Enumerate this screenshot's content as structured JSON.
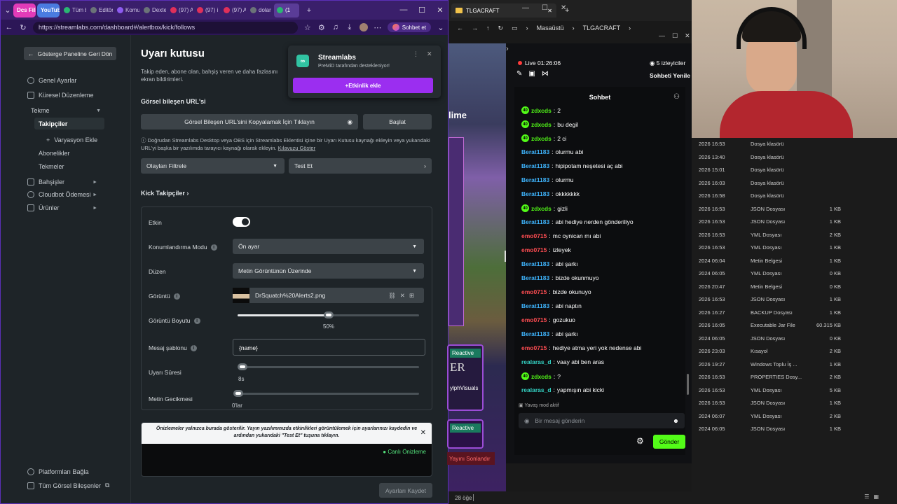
{
  "browser": {
    "tabs": [
      {
        "label": "Dcs Fili",
        "color": "#e23bb8",
        "group": true
      },
      {
        "label": "YouTub",
        "color": "#4a7be0",
        "group": true
      },
      {
        "label": "Tüm b",
        "color": "#2bb673"
      },
      {
        "label": "Editör",
        "color": "#6b7378"
      },
      {
        "label": "Komut",
        "color": "#8d5bf0"
      },
      {
        "label": "Dexte",
        "color": "#6b7378"
      },
      {
        "label": "(97) A",
        "color": "#e0305a"
      },
      {
        "label": "(97) i",
        "color": "#e0305a"
      },
      {
        "label": "(97) A",
        "color": "#e0305a"
      },
      {
        "label": "dolar",
        "color": "#6b7378"
      },
      {
        "label": "(1",
        "color": "#2bb673",
        "active": true
      }
    ],
    "url": "https://streamlabs.com/dashboard#/alertbox/kick/follows",
    "profile_label": "Sohbet et"
  },
  "sidebar": {
    "back_label": "Gösterge Paneline Geri Dön",
    "items": [
      {
        "label": "Genel Ayarlar"
      },
      {
        "label": "Küresel Düzenleme"
      },
      {
        "label": "Tekme"
      },
      {
        "label": "Takipçiler"
      },
      {
        "label": "Varyasyon Ekle"
      },
      {
        "label": "Abonelikler"
      },
      {
        "label": "Tekmeler"
      },
      {
        "label": "Bahşişler"
      },
      {
        "label": "Cloudbot Ödemesi"
      },
      {
        "label": "Ürünler"
      }
    ],
    "bottom": [
      {
        "label": "Platformları Bağla"
      },
      {
        "label": "Tüm Görsel Bileşenler"
      }
    ]
  },
  "main": {
    "title": "Uyarı kutusu",
    "description": "Takip eden, abone olan, bahşiş veren ve daha fazlasını",
    "description2": "ekran bildirimleri.",
    "url_section_label": "Görsel bileşen URL'si",
    "url_field_label": "Görsel Bileşen URL'sini Kopyalamak İçin Tıklayın",
    "start_button": "Başlat",
    "note": "Doğrudan Streamlabs Desktop veya OBS için Streamlabs Eklentisi içine bir Uyarı Kutusu kaynağı ekleyin veya yukarıdaki",
    "note2": "URL'yi başka bir yazılımda tarayıcı kaynağı olarak ekleyin.",
    "note_link": "Kılavuzu Göster",
    "filter_label": "Olayları Filtrele",
    "test_label": "Test Et",
    "section_title": "Kick Takipçiler",
    "rows": {
      "enabled": "Etkin",
      "position_mode": "Konumlandırma Modu",
      "position_value": "Ön ayar",
      "layout": "Düzen",
      "layout_value": "Metin Görüntünün Üzerinde",
      "image": "Görüntü",
      "image_file": "DrSquatch%20Alerts2.png",
      "image_size": "Görüntü Boyutu",
      "image_size_value": "50%",
      "message_template": "Mesaj şablonu",
      "message_value": "{name}",
      "alert_duration": "Uyarı Süresi",
      "alert_duration_value": "8s",
      "text_delay": "Metin Gecikmesi",
      "text_delay_value": "0'lar"
    },
    "image_size_fraction": 0.5,
    "preview_note": "Önizlemeler yalnızca burada gösterilir. Yayın yazılımınızda etkinlikleri görüntülemek için ayarlarınızı kaydedin ve",
    "preview_note2": "ardından yukarıdaki \"Test Et\" tuşuna tıklayın.",
    "live_preview": "Canlı Önizleme",
    "save_button": "Ayarları Kaydet"
  },
  "popup": {
    "title": "Streamlabs",
    "subtitle": "PreMiD tarafından destekleniyor!",
    "button": "Etkinlik ekle"
  },
  "explorer": {
    "title": "TLGACRAFT",
    "breadcrumb": [
      "Masaüstü",
      "TLGACRAFT"
    ],
    "status": "28 öğe"
  },
  "stream": {
    "live": "Live 01:26:06",
    "viewers": "5 izleyiciler",
    "refresh": "Sohbeti Yenile",
    "chat_title": "Sohbet",
    "messages": [
      {
        "user": "zdxcds",
        "text": "2",
        "color": "g",
        "badge": true
      },
      {
        "user": "zdxcds",
        "text": "bu degil",
        "color": "g",
        "badge": true
      },
      {
        "user": "zdxcds",
        "text": "2 ci",
        "color": "g",
        "badge": true
      },
      {
        "user": "Berat1183",
        "text": "olurmu abi",
        "color": "b"
      },
      {
        "user": "Berat1183",
        "text": "hipipotam neşetesi aç abi",
        "color": "b"
      },
      {
        "user": "Berat1183",
        "text": "olurmu",
        "color": "b"
      },
      {
        "user": "Berat1183",
        "text": "okkkkkkk",
        "color": "b"
      },
      {
        "user": "zdxcds",
        "text": "gizli",
        "color": "g",
        "badge": true
      },
      {
        "user": "Berat1183",
        "text": "abi hediye nerden gönderiliyo",
        "color": "b"
      },
      {
        "user": "emo0715",
        "text": "mc oynican mı abi",
        "color": "r"
      },
      {
        "user": "emo0715",
        "text": "izleyek",
        "color": "r"
      },
      {
        "user": "Berat1183",
        "text": "abi şarkı",
        "color": "b"
      },
      {
        "user": "Berat1183",
        "text": "bizde okunmuyo",
        "color": "b"
      },
      {
        "user": "emo0715",
        "text": "bizde okunuyo",
        "color": "r"
      },
      {
        "user": "Berat1183",
        "text": "abi naptın",
        "color": "b"
      },
      {
        "user": "emo0715",
        "text": "gozukuo",
        "color": "r"
      },
      {
        "user": "Berat1183",
        "text": "abi şarkı",
        "color": "b"
      },
      {
        "user": "emo0715",
        "text": "hediye atma yeri yok nedense abi",
        "color": "r"
      },
      {
        "user": "realaras_d",
        "text": "vaay abi ben aras",
        "color": "t"
      },
      {
        "user": "zdxcds",
        "text": "?",
        "color": "g",
        "badge": true
      },
      {
        "user": "realaras_d",
        "text": "yapmışın abi kicki",
        "color": "t"
      }
    ],
    "slow_mode": "Yavaş mod aktif",
    "input_placeholder": "Bir mesaj gönderin",
    "send_button": "Gönder",
    "end_stream": "Yayını Sonlandır",
    "reactive_label": "Reactive",
    "visuals_label": "ylphVisuals",
    "overlay_text": "lime",
    "overlay_text2": "ER"
  },
  "files": [
    {
      "date": "2026 16:53",
      "type": "Dosya klasörü",
      "size": ""
    },
    {
      "date": "2026 13:40",
      "type": "Dosya klasörü",
      "size": ""
    },
    {
      "date": "2026 15:01",
      "type": "Dosya klasörü",
      "size": ""
    },
    {
      "date": "2026 16:03",
      "type": "Dosya klasörü",
      "size": ""
    },
    {
      "date": "2026 16:58",
      "type": "Dosya klasörü",
      "size": ""
    },
    {
      "date": "2026 16:53",
      "type": "JSON Dosyası",
      "size": "1 KB"
    },
    {
      "date": "2026 16:53",
      "type": "JSON Dosyası",
      "size": "1 KB"
    },
    {
      "date": "2026 16:53",
      "type": "YML Dosyası",
      "size": "2 KB"
    },
    {
      "date": "2026 16:53",
      "type": "YML Dosyası",
      "size": "1 KB"
    },
    {
      "date": "2024 06:04",
      "type": "Metin Belgesi",
      "size": "1 KB"
    },
    {
      "date": "2024 06:05",
      "type": "YML Dosyası",
      "size": "0 KB"
    },
    {
      "date": "2026 20:47",
      "type": "Metin Belgesi",
      "size": "0 KB"
    },
    {
      "date": "2026 16:53",
      "type": "JSON Dosyası",
      "size": "1 KB"
    },
    {
      "date": "2026 16:27",
      "type": "BACKUP Dosyası",
      "size": "1 KB"
    },
    {
      "date": "2026 16:05",
      "type": "Executable Jar File",
      "size": "60.315 KB"
    },
    {
      "date": "2024 06:05",
      "type": "JSON Dosyası",
      "size": "0 KB"
    },
    {
      "date": "2026 23:03",
      "type": "Kısayol",
      "size": "2 KB"
    },
    {
      "date": "2026 19:27",
      "type": "Windows Toplu İş ...",
      "size": "1 KB"
    },
    {
      "date": "2026 16:53",
      "type": "PROPERTIES Dosy...",
      "size": "2 KB"
    },
    {
      "date": "2026 16:53",
      "type": "YML Dosyası",
      "size": "5 KB"
    },
    {
      "date": "2026 16:53",
      "type": "JSON Dosyası",
      "size": "1 KB"
    },
    {
      "date": "2024 06:07",
      "type": "YML Dosyası",
      "size": "2 KB"
    },
    {
      "date": "2024 06:05",
      "type": "JSON Dosyası",
      "size": "1 KB"
    }
  ]
}
